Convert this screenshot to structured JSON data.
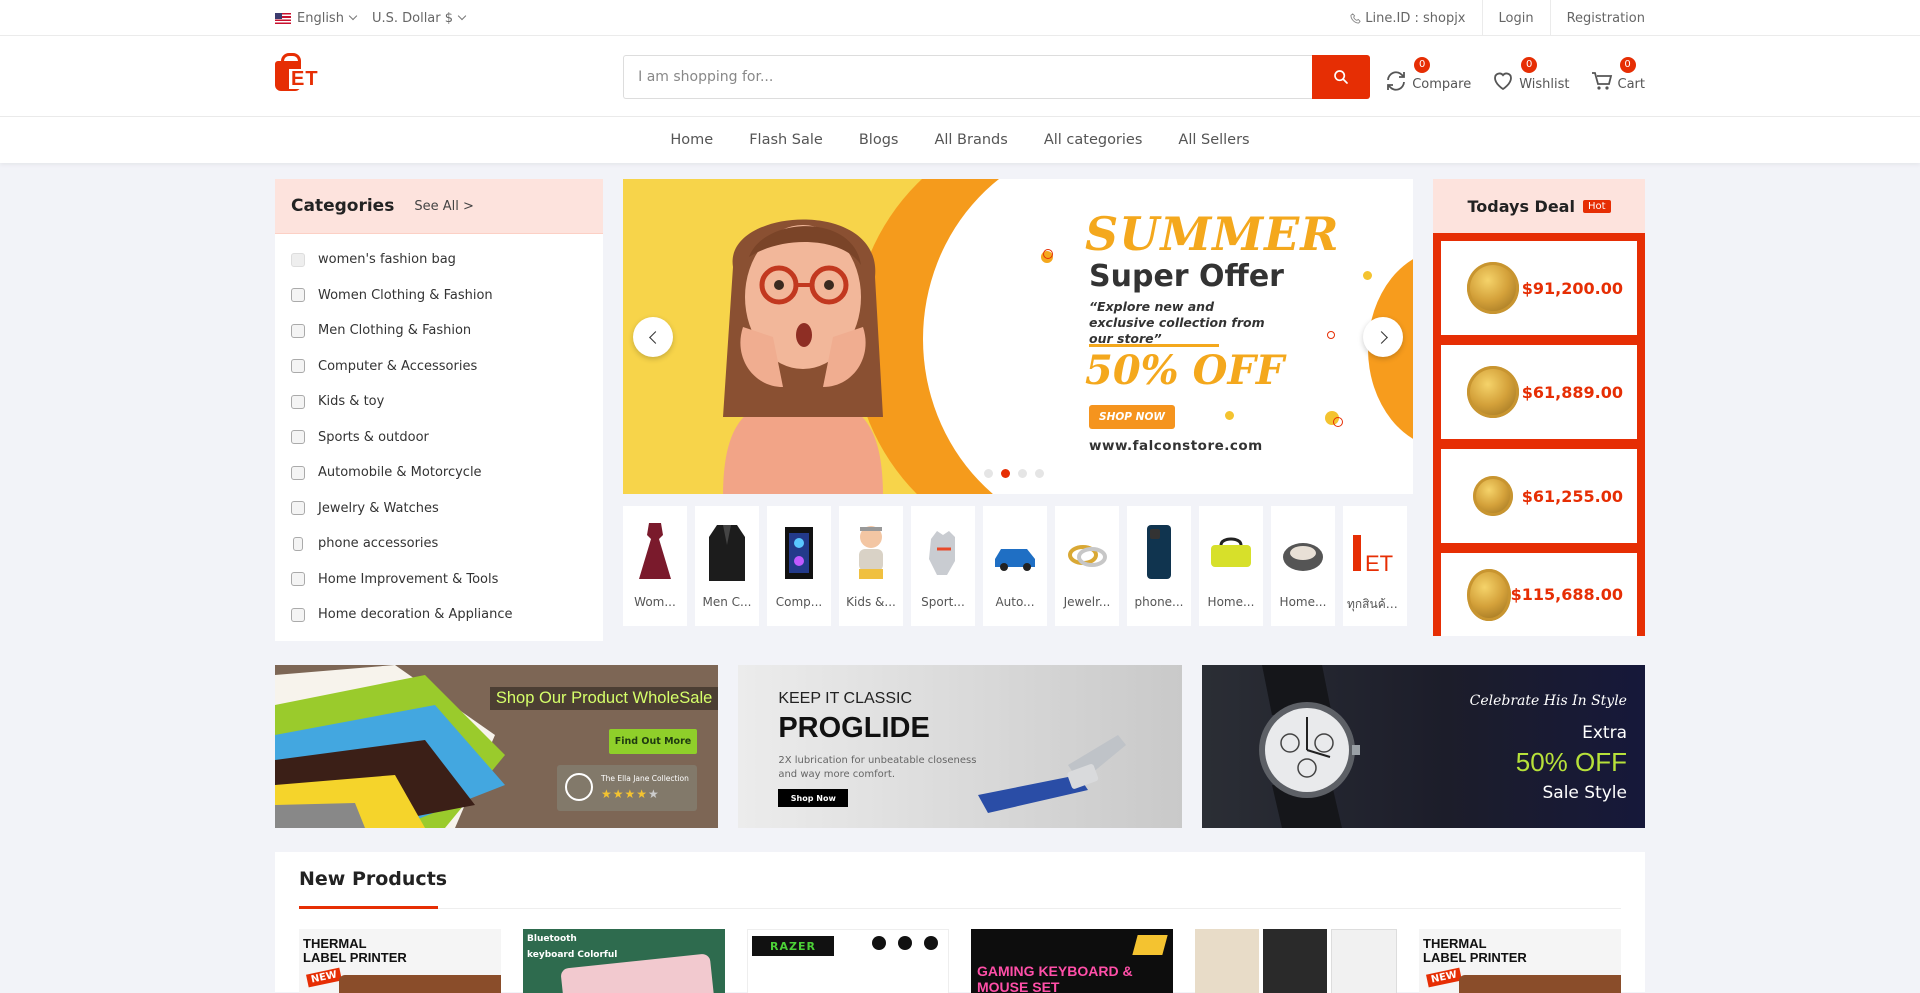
{
  "topbar": {
    "language": "English",
    "currency": "U.S. Dollar $",
    "line_id": "Line.ID : shopjx",
    "login": "Login",
    "registration": "Registration"
  },
  "header": {
    "search_placeholder": "I am shopping for...",
    "compare": {
      "label": "Compare",
      "count": "0"
    },
    "wishlist": {
      "label": "Wishlist",
      "count": "0"
    },
    "cart": {
      "label": "Cart",
      "count": "0"
    }
  },
  "nav": [
    "Home",
    "Flash Sale",
    "Blogs",
    "All Brands",
    "All categories",
    "All Sellers"
  ],
  "categories": {
    "title": "Categories",
    "see_all": "See All >",
    "items": [
      "women's fashion bag",
      "Women Clothing & Fashion",
      "Men Clothing & Fashion",
      "Computer & Accessories",
      "Kids & toy",
      "Sports & outdoor",
      "Automobile & Motorcycle",
      "Jewelry & Watches",
      "phone accessories",
      "Home Improvement & Tools",
      "Home decoration & Appliance"
    ]
  },
  "slider": {
    "headline": "SUMMER",
    "subhead": "Super Offer",
    "desc": "“Explore new and exclusive collection from our store”",
    "discount": "50% OFF",
    "cta": "SHOP NOW",
    "url": "www.falconstore.com",
    "active_slide": 2,
    "slide_count": 4
  },
  "strip": [
    "Wom...",
    "Men C...",
    "Comp...",
    "Kids &...",
    "Sport...",
    "Auto...",
    "Jewelr...",
    "phone...",
    "Home...",
    "Home...",
    "ทุกสินค้า..."
  ],
  "deals": {
    "title": "Todays Deal",
    "hot": "Hot",
    "items": [
      "$91,200.00",
      "$61,889.00",
      "$61,255.00",
      "$115,688.00"
    ]
  },
  "banners": {
    "b1": {
      "title": "Shop Our Product WholeSale",
      "cta": "Find Out More",
      "badge": "The Ella Jane Collection"
    },
    "b2": {
      "kicker": "KEEP IT CLASSIC",
      "title": "PROGLIDE",
      "desc": "2X lubrication for unbeatable closeness and way more comfort.",
      "cta": "Shop Now"
    },
    "b3": {
      "script": "Celebrate His In Style",
      "extra": "Extra",
      "off": "50% OFF",
      "sale": "Sale Style"
    }
  },
  "new_products": {
    "title": "New Products",
    "cards": [
      "THERMAL LABEL PRINTER",
      "Bluetooth keyboard Colorful",
      "RAZER",
      "GAMING KEYBOARD & MOUSE SET",
      "",
      "THERMAL LABEL PRINTER"
    ],
    "card_badges": [
      "NEW",
      "",
      "",
      "",
      "",
      "NEW"
    ]
  },
  "colors": {
    "accent": "#e62e04",
    "deal_bg": "#e62e04",
    "panel_head": "#fde3dd"
  }
}
